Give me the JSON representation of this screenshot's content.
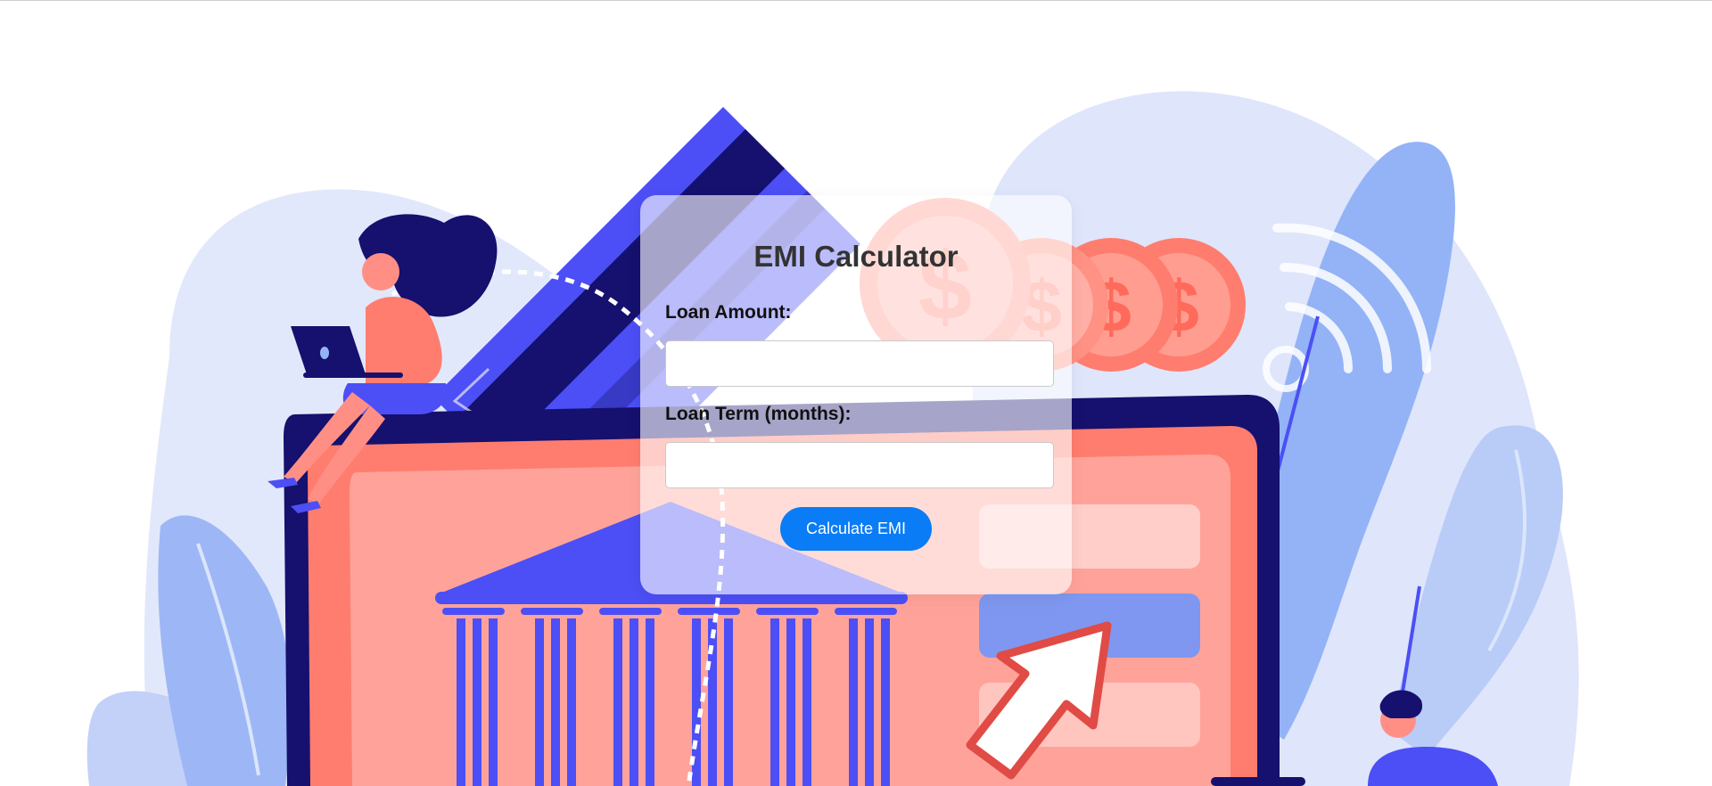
{
  "calculator": {
    "title": "EMI Calculator",
    "loan_amount_label": "Loan Amount:",
    "loan_amount_value": "",
    "loan_term_label": "Loan Term (months):",
    "loan_term_value": "",
    "calculate_button_label": "Calculate EMI"
  },
  "background": {
    "illustration": "online-banking-illustration",
    "icons": [
      "bank-icon",
      "credit-card-icon",
      "dollar-coin-icon",
      "wifi-icon",
      "cursor-arrow-icon",
      "laptop-icon"
    ]
  },
  "colors": {
    "accent": "#0a7cf5",
    "navy": "#16106e",
    "indigo": "#4b4ff5",
    "coral": "#ff7d6e",
    "light_blue": "#dfe5fb",
    "mid_blue": "#93b3f6"
  }
}
